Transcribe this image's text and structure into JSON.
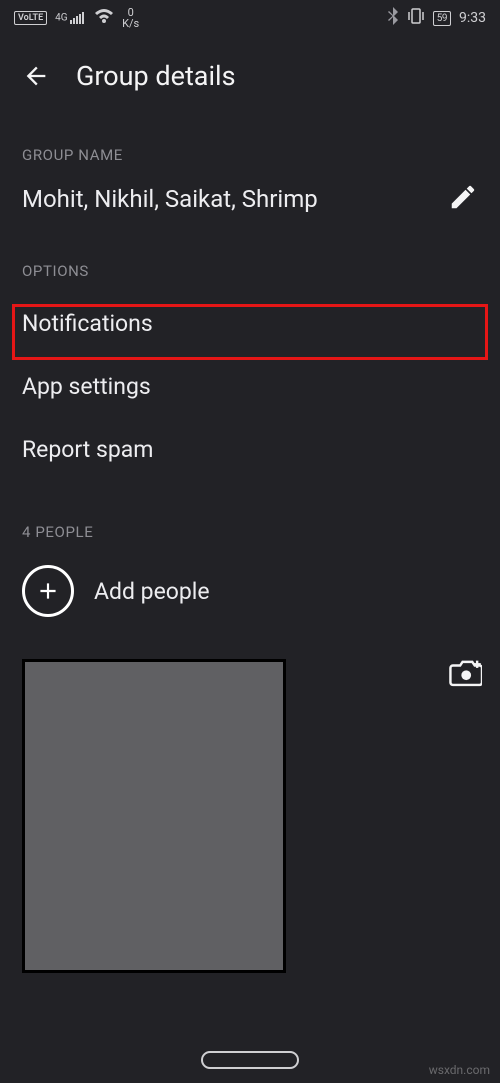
{
  "status": {
    "volte": "VoLTE",
    "network": "4G",
    "speed_value": "0",
    "speed_unit": "K/s",
    "battery": "59",
    "time": "9:33"
  },
  "header": {
    "title": "Group details"
  },
  "group_name": {
    "label": "GROUP NAME",
    "value": "Mohit, Nikhil, Saikat, Shrimp"
  },
  "options": {
    "label": "OPTIONS",
    "items": [
      "Notifications",
      "App settings",
      "Report spam"
    ]
  },
  "people": {
    "label": "4 PEOPLE",
    "add_label": "Add people"
  },
  "watermark": "wsxdn.com"
}
